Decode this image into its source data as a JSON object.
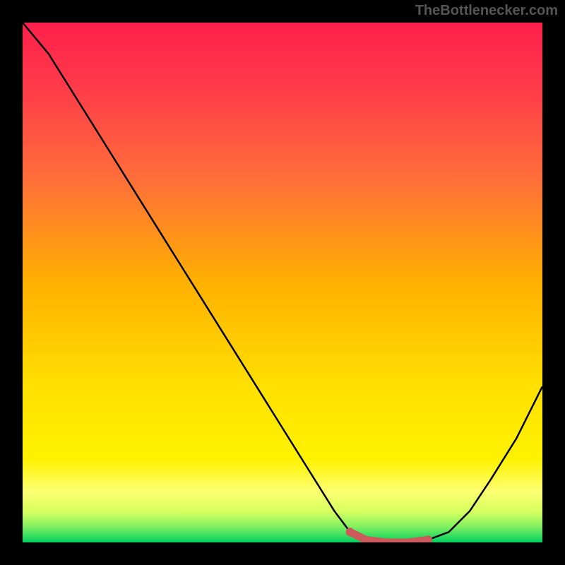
{
  "watermark": "TheBottlenecker.com",
  "chart_data": {
    "type": "line",
    "title": "",
    "xlabel": "",
    "ylabel": "",
    "xlim": [
      0,
      100
    ],
    "ylim": [
      0,
      100
    ],
    "x": [
      0,
      5,
      10,
      15,
      20,
      25,
      30,
      35,
      40,
      45,
      50,
      55,
      60,
      63,
      66,
      70,
      74,
      78,
      82,
      86,
      90,
      95,
      100
    ],
    "values": [
      100,
      94,
      86,
      78,
      70,
      62,
      54,
      46,
      38,
      30,
      22,
      14,
      6,
      2,
      0.5,
      0,
      0,
      0.5,
      2,
      6,
      12,
      20,
      30
    ],
    "highlight": {
      "x": [
        63,
        66,
        70,
        74,
        78
      ],
      "values": [
        2,
        0.5,
        0,
        0,
        0.5
      ]
    },
    "background_gradient": {
      "top": "#ff2a4a",
      "mid": "#ffd400",
      "bottom": "#00d060"
    }
  }
}
